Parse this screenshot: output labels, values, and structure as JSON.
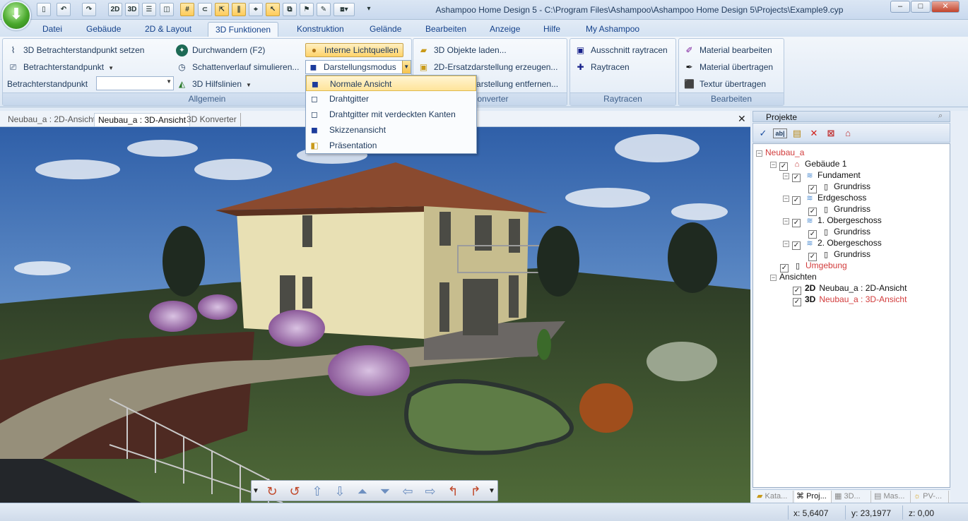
{
  "window": {
    "title": "Ashampoo Home Design 5 - C:\\Program Files\\Ashampoo\\Ashampoo Home Design 5\\Projects\\Example9.cyp",
    "minimize": "–",
    "maximize": "□",
    "close": "✕"
  },
  "quick_access": {
    "btn_2d": "2D",
    "btn_3d": "3D"
  },
  "ribbon_tabs": [
    "Datei",
    "Gebäude",
    "2D & Layout",
    "3D Funktionen",
    "Konstruktion",
    "Gelände",
    "Bearbeiten",
    "Anzeige",
    "Hilfe",
    "My Ashampoo"
  ],
  "help_label": "?",
  "ribbon": {
    "allgemein": {
      "caption": "Allgemein",
      "set_viewpoint": "3D Betrachterstandpunkt setzen",
      "viewpoint": "Betrachterstandpunkt",
      "viewpoint_label": "Betrachterstandpunkt",
      "walk": "Durchwandern (F2)",
      "shadow": "Schattenverlauf simulieren...",
      "guides": "3D Hilfslinien",
      "internal_lights": "Interne Lichtquellen",
      "display_mode": "Darstellungsmodus"
    },
    "konverter": {
      "caption": "Konverter",
      "load": "3D Objekte laden...",
      "create2d": "2D-Ersatzdarstellung erzeugen...",
      "remove2d": "2D-Ersatzdarstellung entfernen..."
    },
    "raytracen": {
      "caption": "Raytracen",
      "section": "Ausschnitt raytracen",
      "raytrace": "Raytracen"
    },
    "bearbeiten": {
      "caption": "Bearbeiten",
      "edit_material": "Material bearbeiten",
      "transfer_material": "Material übertragen",
      "transfer_texture": "Textur übertragen"
    }
  },
  "display_menu": [
    "Normale Ansicht",
    "Drahtgitter",
    "Drahtgitter mit verdeckten Kanten",
    "Skizzenansicht",
    "Präsentation"
  ],
  "doc_tabs": [
    "Neubau_a : 2D-Ansicht",
    "Neubau_a : 3D-Ansicht",
    "3D Konverter"
  ],
  "doc_close": "✕",
  "panel": {
    "title": "Projekte",
    "tree": {
      "root": "Neubau_a",
      "building": "Gebäude 1",
      "floors": [
        "Fundament",
        "Erdgeschoss",
        "1. Obergeschoss",
        "2. Obergeschoss"
      ],
      "plan": "Grundriss",
      "environment": "Umgebung",
      "views_label": "Ansichten",
      "view_2d_tag": "2D",
      "view_3d_tag": "3D",
      "view_2d": "Neubau_a : 2D-Ansicht",
      "view_3d": "Neubau_a : 3D-Ansicht"
    },
    "tabs": [
      "Kata...",
      "Proj...",
      "3D...",
      "Mas...",
      "PV-..."
    ]
  },
  "status": {
    "x": "x: 5,6407",
    "y": "y: 23,1977",
    "z": "z: 0,00"
  },
  "colors": {
    "accent_highlight": "#ffd36a",
    "ribbon_text": "#15428b",
    "tree_red": "#d23c3c"
  }
}
